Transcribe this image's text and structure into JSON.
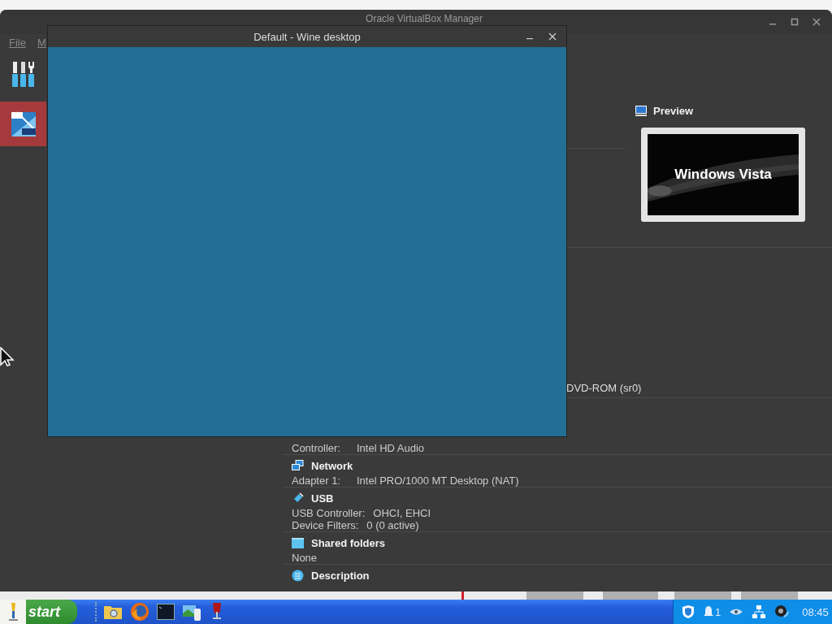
{
  "manager": {
    "title": "Oracle VirtualBox Manager",
    "menu": [
      "File",
      "M"
    ],
    "vm_item": {
      "selected": true
    },
    "preview": {
      "title": "Preview",
      "screen_text": "Windows Vista"
    },
    "details": [
      {
        "kind": "line",
        "value": "DVD-ROM (sr0)"
      },
      {
        "kind": "gap"
      },
      {
        "kind": "field",
        "label": "Controller:",
        "value": "Intel HD Audio"
      },
      {
        "kind": "header",
        "title": "Network"
      },
      {
        "kind": "field",
        "label": "Adapter 1:",
        "value": "Intel PRO/1000 MT Desktop (NAT)"
      },
      {
        "kind": "header",
        "title": "USB"
      },
      {
        "kind": "field",
        "label": "USB Controller:",
        "value": "OHCI, EHCI"
      },
      {
        "kind": "field",
        "label": "Device Filters:",
        "value": "0 (0 active)"
      },
      {
        "kind": "header",
        "title": "Shared folders"
      },
      {
        "kind": "line0",
        "value": "None"
      },
      {
        "kind": "header",
        "title": "Description"
      }
    ]
  },
  "wine_window": {
    "title": "Default - Wine desktop"
  },
  "taskbar": {
    "start": "start",
    "tray_badge": "1",
    "clock": "08:45"
  }
}
